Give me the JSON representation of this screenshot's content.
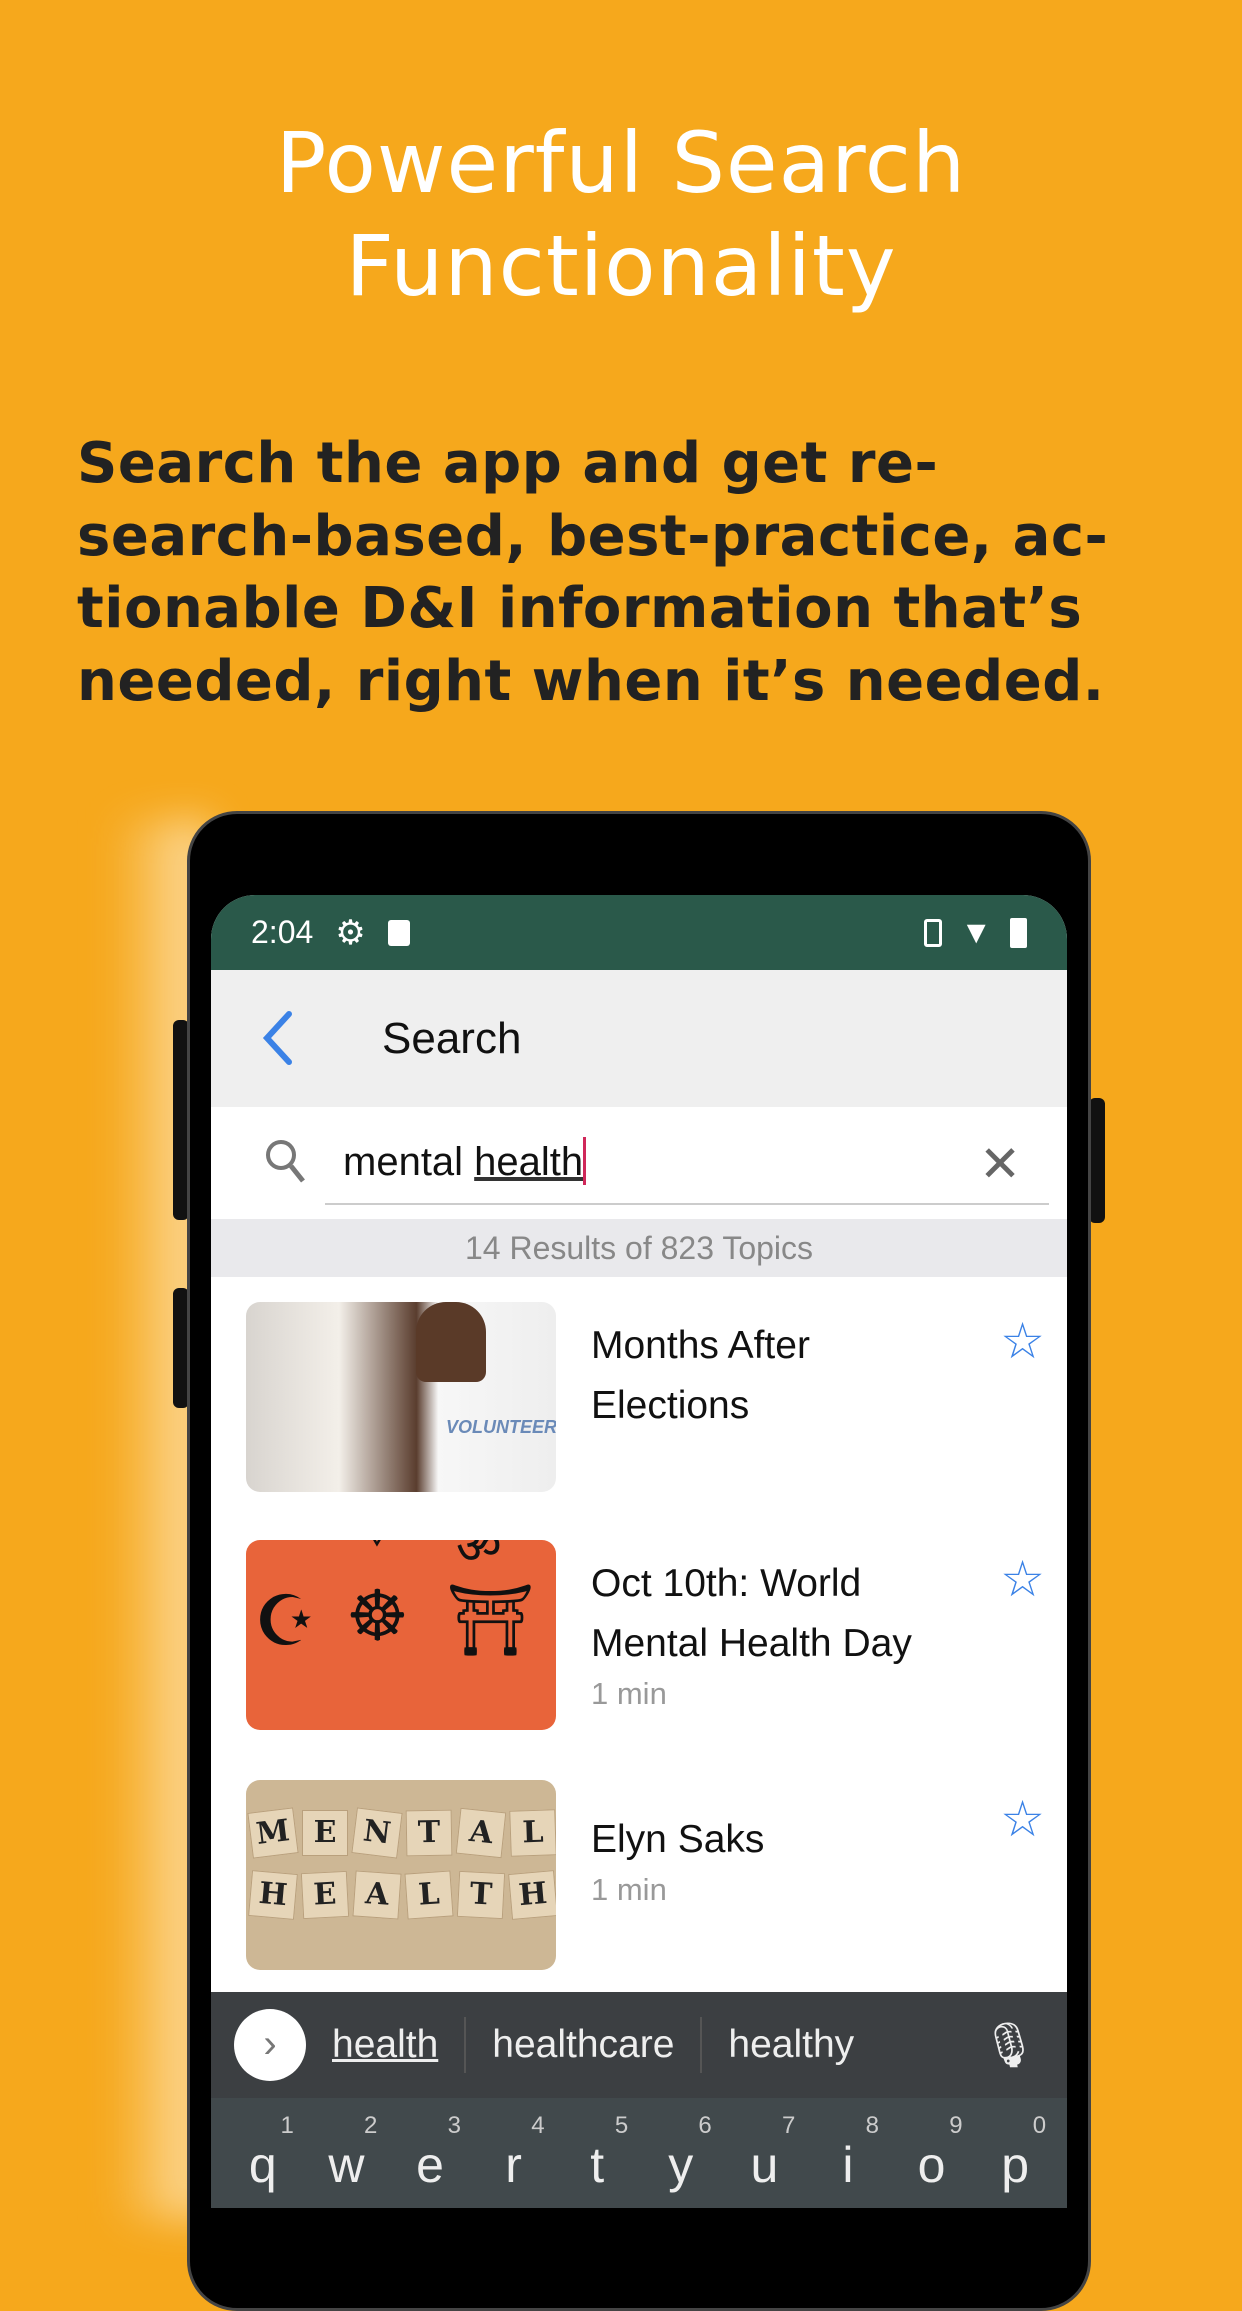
{
  "hero": {
    "title_lines": [
      "Powerful Search",
      "Functionality"
    ],
    "desc_lines": [
      "Search the app and get re-",
      "search-based, best-practice, ac-",
      "tionable D&I information that’s",
      "needed, right when it’s needed."
    ]
  },
  "status_bar": {
    "time": "2:04",
    "icons": [
      "gear-icon",
      "sim-icon",
      "vibrate-icon",
      "wifi-icon",
      "battery-icon"
    ]
  },
  "header": {
    "title": "Search"
  },
  "search": {
    "value_plain": "mental ",
    "value_underlined": "health",
    "results": "14 Results of 823 Topics"
  },
  "results": [
    {
      "title_lines": [
        "Months After",
        "Elections"
      ],
      "duration": "",
      "image_text": "VOLUNTEER"
    },
    {
      "title_lines": [
        "Oct 10th: World",
        "Mental Health Day"
      ],
      "duration": "1 min"
    },
    {
      "title_lines": [
        "Elyn Saks"
      ],
      "duration": "1 min",
      "image_tiles": [
        "M",
        "E",
        "N",
        "T",
        "A",
        "L",
        "H",
        "E",
        "A",
        "L",
        "T",
        "H"
      ]
    }
  ],
  "keyboard": {
    "suggestions": [
      "health",
      "healthcare",
      "healthy"
    ],
    "keys": [
      {
        "k": "q",
        "n": "1"
      },
      {
        "k": "w",
        "n": "2"
      },
      {
        "k": "e",
        "n": "3"
      },
      {
        "k": "r",
        "n": "4"
      },
      {
        "k": "t",
        "n": "5"
      },
      {
        "k": "y",
        "n": "6"
      },
      {
        "k": "u",
        "n": "7"
      },
      {
        "k": "i",
        "n": "8"
      },
      {
        "k": "o",
        "n": "9"
      },
      {
        "k": "p",
        "n": "0"
      }
    ]
  },
  "colors": {
    "background": "#f6a81c",
    "status_bar": "#2a594a",
    "accent": "#3b82e6",
    "caret": "#d0285a"
  }
}
